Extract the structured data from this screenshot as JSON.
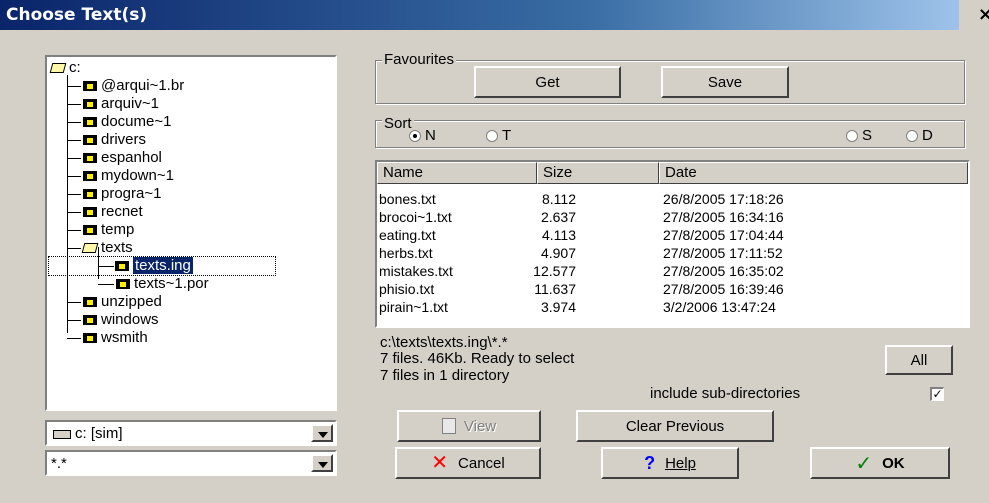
{
  "window": {
    "title": "Choose Text(s)",
    "close": "×"
  },
  "tree": {
    "root": "c:",
    "items": [
      {
        "label": "@arqui~1.br"
      },
      {
        "label": "arquiv~1"
      },
      {
        "label": "docume~1"
      },
      {
        "label": "drivers"
      },
      {
        "label": "espanhol"
      },
      {
        "label": "mydown~1"
      },
      {
        "label": "progra~1"
      },
      {
        "label": "recnet"
      },
      {
        "label": "temp"
      },
      {
        "label": "texts"
      },
      {
        "label": "texts.ing"
      },
      {
        "label": "texts~1.por"
      },
      {
        "label": "unzipped"
      },
      {
        "label": "windows"
      },
      {
        "label": "wsmith"
      }
    ]
  },
  "drive_combo": {
    "value": "c: [sim]"
  },
  "filter_combo": {
    "value": "*.*"
  },
  "favourites": {
    "legend": "Favourites",
    "get": "Get",
    "save": "Save"
  },
  "sort": {
    "legend": "Sort",
    "options": [
      {
        "label": "N",
        "selected": true
      },
      {
        "label": "T",
        "selected": false
      },
      {
        "label": "S",
        "selected": false
      },
      {
        "label": "D",
        "selected": false
      }
    ]
  },
  "file_list": {
    "columns": [
      "Name",
      "Size",
      "Date"
    ],
    "rows": [
      {
        "name": "bones.txt",
        "size": "8.112",
        "date": "26/8/2005 17:18:26"
      },
      {
        "name": "brocoi~1.txt",
        "size": "2.637",
        "date": "27/8/2005 16:34:16"
      },
      {
        "name": "eating.txt",
        "size": "4.113",
        "date": "27/8/2005 17:04:44"
      },
      {
        "name": "herbs.txt",
        "size": "4.907",
        "date": "27/8/2005 17:11:52"
      },
      {
        "name": "mistakes.txt",
        "size": "12.577",
        "date": "27/8/2005 16:35:02"
      },
      {
        "name": "phisio.txt",
        "size": "11.637",
        "date": "27/8/2005 16:39:46"
      },
      {
        "name": "pirain~1.txt",
        "size": "3.974",
        "date": "3/2/2006 13:47:24"
      }
    ]
  },
  "status": {
    "path": "c:\\texts\\texts.ing\\*.*",
    "line1": "7 files. 46Kb. Ready to select",
    "line2": "7 files in 1 directory"
  },
  "buttons": {
    "all": "All",
    "include_sub": "include sub-directories",
    "include_checked": "✓",
    "view": "View",
    "clear_previous": "Clear Previous",
    "cancel": "Cancel",
    "help": "Help",
    "ok": "OK"
  },
  "icons": {
    "cancel": "x-icon",
    "help": "question-icon",
    "ok": "check-icon",
    "view": "document-icon",
    "drive": "drive-icon"
  },
  "colors": {
    "titlebar": "#0a246a",
    "selection": "#0a246a",
    "face": "#d4d0c8",
    "cancel_x": "#ff0000",
    "help_q": "#0000ff",
    "ok_check": "#008000"
  }
}
